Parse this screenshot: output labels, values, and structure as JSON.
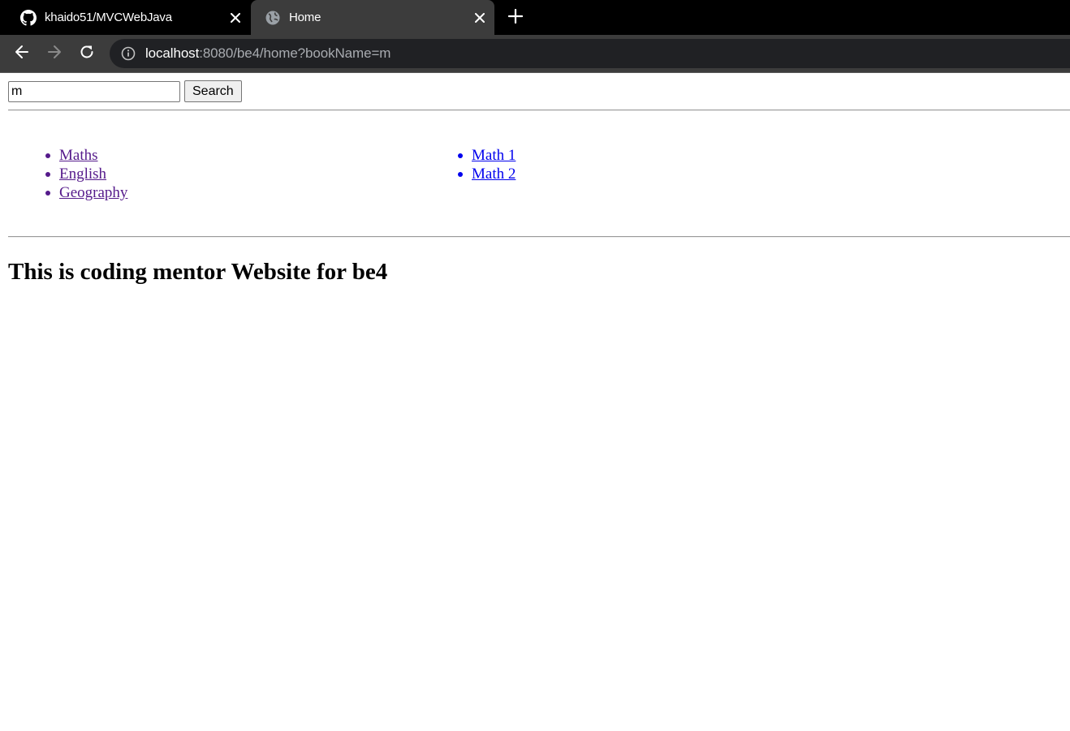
{
  "browser": {
    "tabs": [
      {
        "title": "khaido51/MVCWebJava",
        "favicon": "github-icon",
        "active": false
      },
      {
        "title": "Home",
        "favicon": "globe-icon",
        "active": true
      }
    ],
    "url": {
      "host": "localhost",
      "rest": ":8080/be4/home?bookName=m"
    }
  },
  "page": {
    "search": {
      "value": "m",
      "button_label": "Search"
    },
    "categories": [
      {
        "label": "Maths"
      },
      {
        "label": "English"
      },
      {
        "label": "Geography"
      }
    ],
    "books": [
      {
        "label": "Math 1"
      },
      {
        "label": "Math 2"
      }
    ],
    "heading": "This is coding mentor Website for be4"
  },
  "colors": {
    "visited_link": "#551a8b",
    "link": "#0000ee",
    "toolbar_bg": "#3c3c3c",
    "tabstrip_bg": "#000000"
  }
}
